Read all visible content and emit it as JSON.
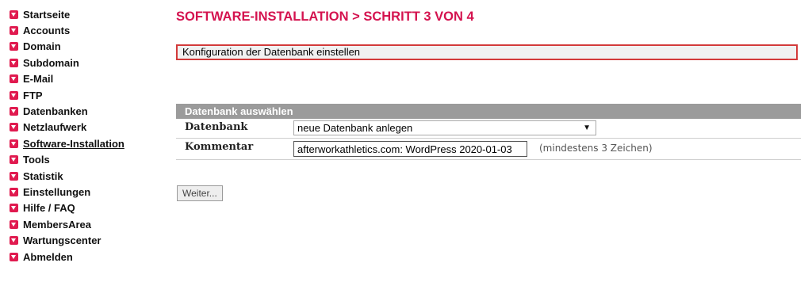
{
  "sidebar": {
    "items": [
      {
        "label": "Startseite",
        "active": false
      },
      {
        "label": "Accounts",
        "active": false
      },
      {
        "label": "Domain",
        "active": false
      },
      {
        "label": "Subdomain",
        "active": false
      },
      {
        "label": "E-Mail",
        "active": false
      },
      {
        "label": "FTP",
        "active": false
      },
      {
        "label": "Datenbanken",
        "active": false
      },
      {
        "label": "Netzlaufwerk",
        "active": false
      },
      {
        "label": "Software-Installation",
        "active": true
      },
      {
        "label": "Tools",
        "active": false
      },
      {
        "label": "Statistik",
        "active": false
      },
      {
        "label": "Einstellungen",
        "active": false
      },
      {
        "label": "Hilfe / FAQ",
        "active": false
      },
      {
        "label": "MembersArea",
        "active": false
      },
      {
        "label": "Wartungscenter",
        "active": false
      },
      {
        "label": "Abmelden",
        "active": false
      }
    ],
    "bullet_icon": "red-square-down-arrow-icon",
    "accent_color": "#e01a4f"
  },
  "main": {
    "title": "SOFTWARE-INSTALLATION > SCHRITT 3 VON 4",
    "title_color": "#d4134f",
    "info_text": "Konfiguration der Datenbank einstellen",
    "section_title": "Datenbank auswählen",
    "form": {
      "db_label": "Datenbank",
      "db_selected": "neue Datenbank anlegen",
      "comment_label": "Kommentar",
      "comment_value": "afterworkathletics.com: WordPress 2020-01-03",
      "comment_hint": "(mindestens 3 Zeichen)"
    },
    "next_button": "Weiter..."
  }
}
